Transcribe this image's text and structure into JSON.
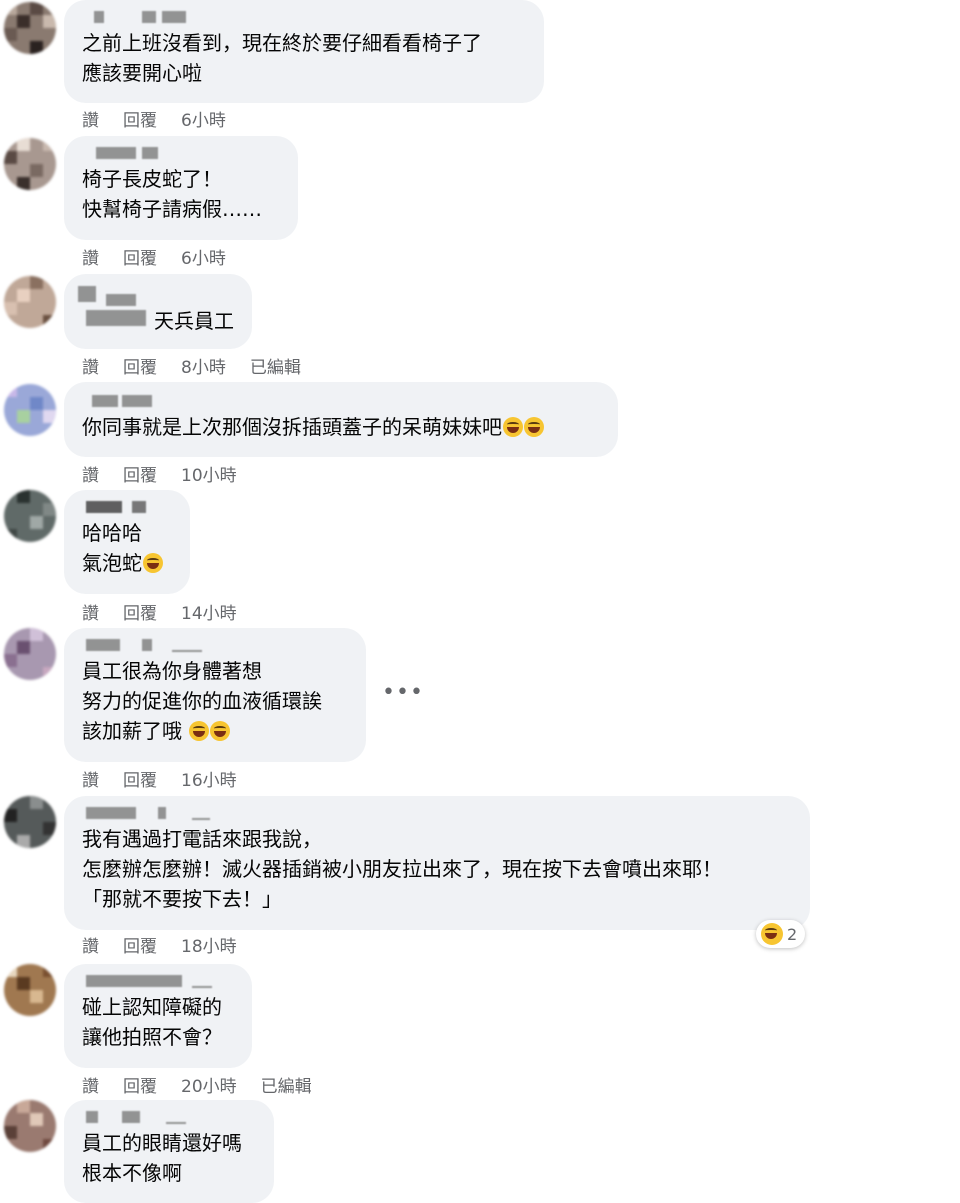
{
  "comments": [
    {
      "lines": [
        "之前上班沒看到，現在終於要仔細看看椅子了",
        "應該要開心啦"
      ],
      "actions": {
        "like": "讚",
        "reply": "回覆",
        "time": "6小時"
      }
    },
    {
      "lines": [
        "椅子長皮蛇了！",
        "快幫椅子請病假……"
      ],
      "actions": {
        "like": "讚",
        "reply": "回覆",
        "time": "6小時"
      }
    },
    {
      "lines": [
        "天兵員工"
      ],
      "actions": {
        "like": "讚",
        "reply": "回覆",
        "time": "8小時",
        "edited": "已編輯"
      }
    },
    {
      "lines": [
        "你同事就是上次那個沒拆插頭蓋子的呆萌妹妹吧"
      ],
      "emojis": [
        "rolling-on-floor-laughing",
        "rolling-on-floor-laughing"
      ],
      "actions": {
        "like": "讚",
        "reply": "回覆",
        "time": "10小時"
      }
    },
    {
      "lines": [
        "哈哈哈",
        "氣泡蛇"
      ],
      "emojis": [
        "rolling-on-floor-laughing"
      ],
      "actions": {
        "like": "讚",
        "reply": "回覆",
        "time": "14小時"
      }
    },
    {
      "lines": [
        "員工很為你身體著想",
        "努力的促進你的血液循環誒",
        "該加薪了哦"
      ],
      "emojis": [
        "tears-of-joy",
        "tears-of-joy"
      ],
      "more": "•••",
      "actions": {
        "like": "讚",
        "reply": "回覆",
        "time": "16小時"
      }
    },
    {
      "lines": [
        "我有遇過打電話來跟我說，",
        "怎麼辦怎麼辦！滅火器插銷被小朋友拉出來了，現在按下去會噴出來耶！",
        "「那就不要按下去！」"
      ],
      "reaction": {
        "icon": "tears-of-joy",
        "count": "2"
      },
      "actions": {
        "like": "讚",
        "reply": "回覆",
        "time": "18小時"
      }
    },
    {
      "lines": [
        "碰上認知障礙的",
        "讓他拍照不會？"
      ],
      "actions": {
        "like": "讚",
        "reply": "回覆",
        "time": "20小時",
        "edited": "已編輯"
      }
    },
    {
      "lines": [
        "員工的眼睛還好嗎",
        "根本不像啊"
      ]
    }
  ]
}
